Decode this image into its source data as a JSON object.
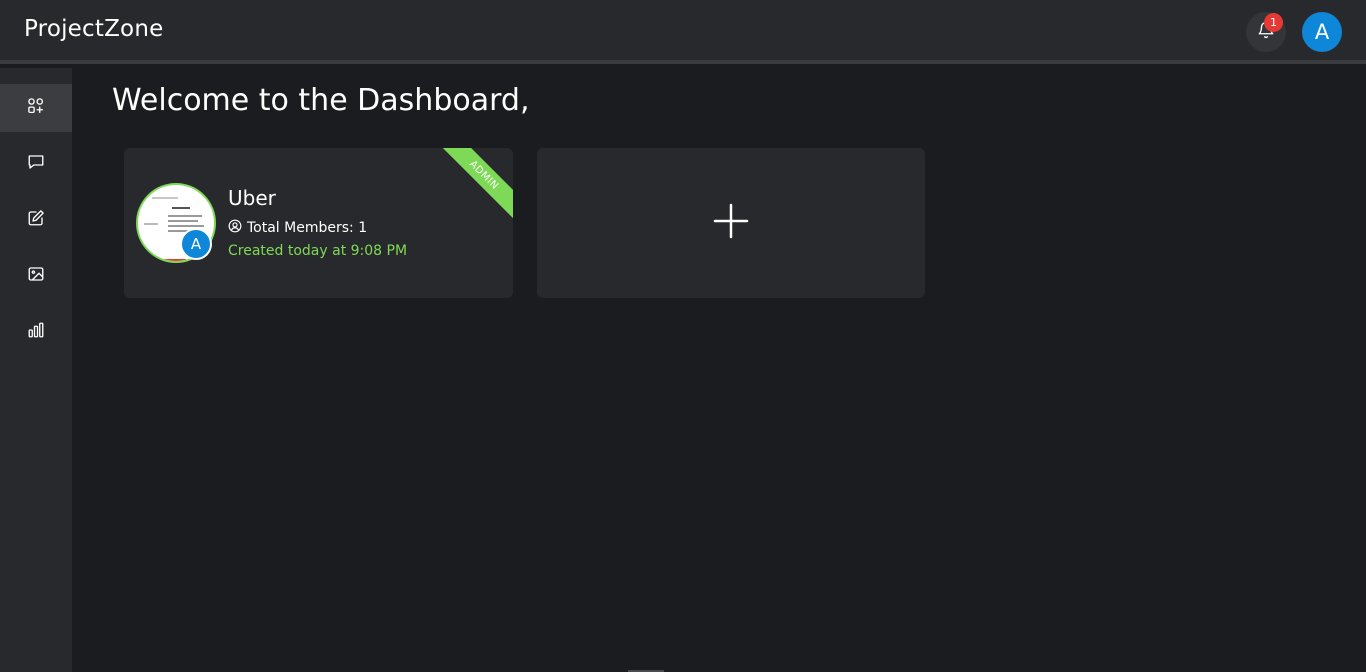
{
  "app": {
    "title": "ProjectZone"
  },
  "header": {
    "notification_count": "1",
    "user_initial": "A",
    "colors": {
      "avatar": "#0f87d9",
      "badge": "#e53935",
      "bar": "#28292c"
    }
  },
  "sidebar": {
    "items": [
      {
        "icon": "dashboard-icon",
        "active": true
      },
      {
        "icon": "chat-icon",
        "active": false
      },
      {
        "icon": "edit-icon",
        "active": false
      },
      {
        "icon": "image-icon",
        "active": false
      },
      {
        "icon": "bar-chart-icon",
        "active": false
      }
    ]
  },
  "main": {
    "heading": "Welcome to the Dashboard,",
    "projects": [
      {
        "name": "Uber",
        "members_label": "Total Members: 1",
        "created": "Created today at 9:08 PM",
        "role_ribbon": "ADMIN",
        "owner_initial": "A",
        "accent_color": "#7ed957"
      }
    ],
    "add_card_icon": "plus-icon"
  }
}
